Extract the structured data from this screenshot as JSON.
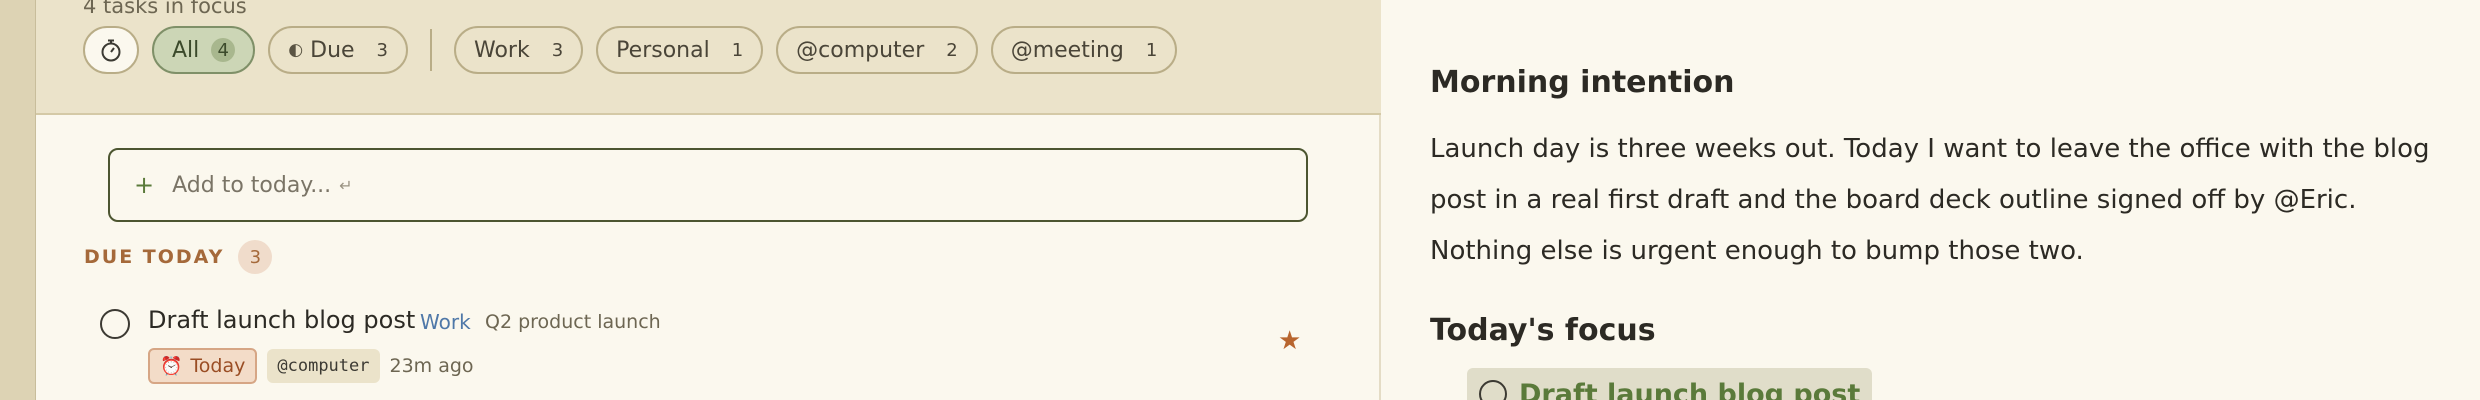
{
  "filters": {
    "focus_count": "4 tasks in focus",
    "timer_icon": "stopwatch",
    "chips": [
      {
        "label": "All",
        "count": "4"
      },
      {
        "label": "Due",
        "count": "3"
      },
      {
        "label": "Work",
        "count": "3"
      },
      {
        "label": "Personal",
        "count": "1"
      },
      {
        "label": "@computer",
        "count": "2"
      },
      {
        "label": "@meeting",
        "count": "1"
      }
    ]
  },
  "add_task": {
    "placeholder": "Add to today...",
    "plus": "+",
    "enter_hint": "↵"
  },
  "due_today": {
    "title": "DUE TODAY",
    "count": "3"
  },
  "tasks": [
    {
      "title": "Draft launch blog post",
      "project": "Work",
      "goal": "Q2 product launch",
      "date": "Today",
      "context": "@computer",
      "age": "23m ago",
      "starred": "★"
    }
  ],
  "notes": {
    "intention_heading": "Morning intention",
    "intention_text": "Launch day is three weeks out. Today I want to leave the office with the blog post in a real first draft and the board deck outline signed off by @Eric. Nothing else is urgent enough to bump those two.",
    "focus_heading": "Today's focus",
    "focus_items": [
      {
        "label": "Draft launch blog post"
      }
    ]
  },
  "colors": {
    "accent_green": "#5a7a3a",
    "due_orange": "#a5693a",
    "project_blue": "#4f78a8",
    "filter_bg": "#ebe3ca"
  }
}
